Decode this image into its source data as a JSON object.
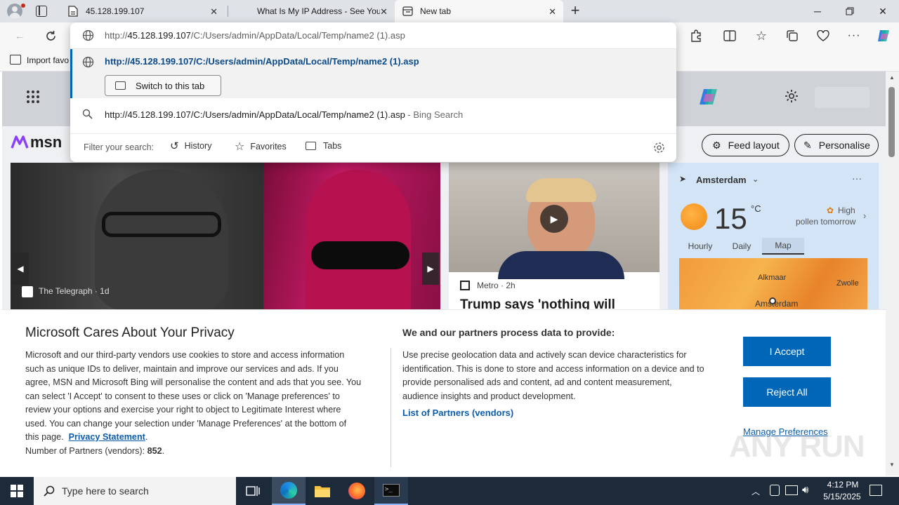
{
  "tabs": [
    {
      "title": "45.128.199.107",
      "icon": "page-icon"
    },
    {
      "title": "What Is My IP Address - See Your",
      "icon": "blank-icon"
    },
    {
      "title": "New tab",
      "icon": "newtab-icon"
    }
  ],
  "address_bar": {
    "prefix": "http://",
    "host": "45.128.199.107",
    "path": "/C:/Users/admin/AppData/Local/Temp/name2 (1).asp"
  },
  "favorites_bar": {
    "import_label": "Import favo"
  },
  "omnibox": {
    "suggestion_url": "http://45.128.199.107/C:/Users/admin/AppData/Local/Temp/name2 (1).asp",
    "switch_tab_label": "Switch to this tab",
    "search_query": "http://45.128.199.107/C:/Users/admin/AppData/Local/Temp/name2 (1).asp",
    "search_suffix": " - Bing Search",
    "filter_label": "Filter your search:",
    "filters": [
      "History",
      "Favorites",
      "Tabs"
    ]
  },
  "msn": {
    "logo_text": "msn",
    "feed_layout": "Feed layout",
    "personalise": "Personalise",
    "card1": {
      "source": "The Telegraph",
      "age": "1d"
    },
    "card2": {
      "source": "Metro",
      "age": "2h",
      "headline": "Trump says 'nothing will"
    },
    "weather": {
      "location": "Amsterdam",
      "temp": "15",
      "unit": "°C",
      "pollen_level": "High",
      "pollen_text": "pollen tomorrow",
      "tabs": [
        "Hourly",
        "Daily",
        "Map"
      ],
      "map_labels": [
        "Alkmaar",
        "Zwolle",
        "Amsterdam"
      ]
    }
  },
  "privacy": {
    "title": "Microsoft Cares About Your Privacy",
    "body_lines": [
      "Microsoft and our third-party vendors use cookies to store and access information",
      "such as unique IDs to deliver, maintain and improve our services and ads. If you",
      "agree, MSN and Microsoft Bing will personalise the content and ads that you see. You",
      "can select 'I Accept' to consent to these uses or click on 'Manage preferences' to",
      "review your options and exercise your right to object to Legitimate Interest where",
      "used.  You can change your selection under 'Manage Preferences' at the bottom of"
    ],
    "body_last_prefix": "this page.",
    "privacy_link": "Privacy Statement",
    "partners_label": "Number of Partners (vendors):",
    "partners_count": "852",
    "right_title": "We and our partners process data to provide:",
    "right_lines": [
      "Use precise geolocation data and actively scan device characteristics for",
      "identification. This is done to store and access information on a device and to",
      "provide personalised ads and content, ad and content measurement,",
      "audience insights and product development."
    ],
    "partners_link": "List of Partners (vendors)",
    "accept": "I Accept",
    "reject": "Reject All",
    "manage": "Manage Preferences"
  },
  "taskbar": {
    "search_placeholder": "Type here to search",
    "time": "4:12 PM",
    "date": "5/15/2025"
  },
  "watermark": "ANY RUN",
  "colors": {
    "accent": "#0067b8",
    "link": "#0b5cad",
    "taskbar": "#1c2a3a",
    "titlebar": "#dfe3e8"
  }
}
